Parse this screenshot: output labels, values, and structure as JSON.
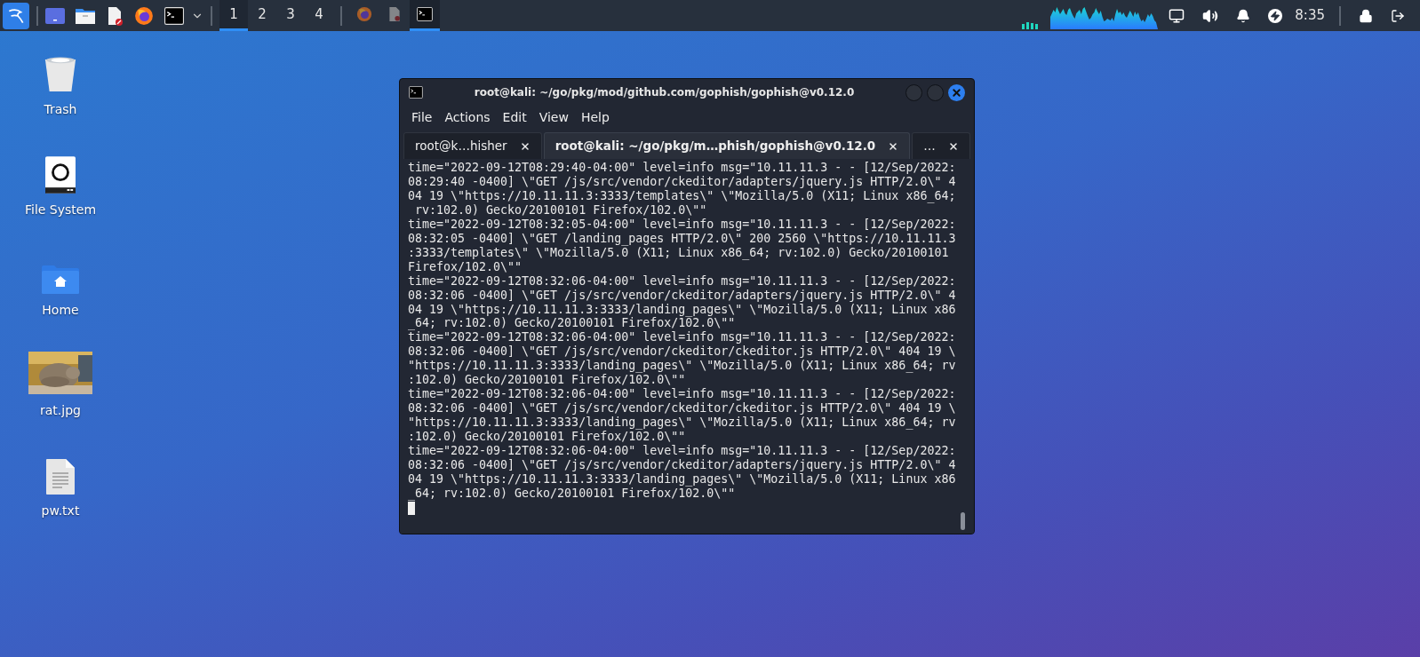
{
  "taskbar": {
    "workspaces": [
      {
        "label": "1",
        "selected": true
      },
      {
        "label": "2",
        "selected": false
      },
      {
        "label": "3",
        "selected": false
      },
      {
        "label": "4",
        "selected": false
      }
    ],
    "tasks": [
      {
        "kind": "browser",
        "selected": false
      },
      {
        "kind": "document",
        "selected": false
      },
      {
        "kind": "terminal",
        "selected": true
      }
    ],
    "clock": "8:35"
  },
  "desktop_icons": [
    {
      "label": "Trash",
      "kind": "trash"
    },
    {
      "label": "File System",
      "kind": "drive"
    },
    {
      "label": "Home",
      "kind": "home"
    },
    {
      "label": "rat.jpg",
      "kind": "picture"
    },
    {
      "label": "pw.txt",
      "kind": "text"
    }
  ],
  "terminal": {
    "title": "root@kali: ~/go/pkg/mod/github.com/gophish/gophish@v0.12.0",
    "menu": [
      "File",
      "Actions",
      "Edit",
      "View",
      "Help"
    ],
    "tabs": [
      {
        "label": "root@k…hisher",
        "selected": false
      },
      {
        "label": "root@kali: ~/go/pkg/m…phish/gophish@v0.12.0",
        "selected": true
      },
      {
        "label": "…",
        "selected": false
      }
    ],
    "lines": [
      "time=\"2022-09-12T08:29:40-04:00\" level=info msg=\"10.11.11.3 - - [12/Sep/2022:",
      "08:29:40 -0400] \\\"GET /js/src/vendor/ckeditor/adapters/jquery.js HTTP/2.0\\\" 4",
      "04 19 \\\"https://10.11.11.3:3333/templates\\\" \\\"Mozilla/5.0 (X11; Linux x86_64;",
      " rv:102.0) Gecko/20100101 Firefox/102.0\\\"\"",
      "time=\"2022-09-12T08:32:05-04:00\" level=info msg=\"10.11.11.3 - - [12/Sep/2022:",
      "08:32:05 -0400] \\\"GET /landing_pages HTTP/2.0\\\" 200 2560 \\\"https://10.11.11.3",
      ":3333/templates\\\" \\\"Mozilla/5.0 (X11; Linux x86_64; rv:102.0) Gecko/20100101",
      "Firefox/102.0\\\"\"",
      "time=\"2022-09-12T08:32:06-04:00\" level=info msg=\"10.11.11.3 - - [12/Sep/2022:",
      "08:32:06 -0400] \\\"GET /js/src/vendor/ckeditor/adapters/jquery.js HTTP/2.0\\\" 4",
      "04 19 \\\"https://10.11.11.3:3333/landing_pages\\\" \\\"Mozilla/5.0 (X11; Linux x86",
      "_64; rv:102.0) Gecko/20100101 Firefox/102.0\\\"\"",
      "time=\"2022-09-12T08:32:06-04:00\" level=info msg=\"10.11.11.3 - - [12/Sep/2022:",
      "08:32:06 -0400] \\\"GET /js/src/vendor/ckeditor/ckeditor.js HTTP/2.0\\\" 404 19 \\",
      "\"https://10.11.11.3:3333/landing_pages\\\" \\\"Mozilla/5.0 (X11; Linux x86_64; rv",
      ":102.0) Gecko/20100101 Firefox/102.0\\\"\"",
      "time=\"2022-09-12T08:32:06-04:00\" level=info msg=\"10.11.11.3 - - [12/Sep/2022:",
      "08:32:06 -0400] \\\"GET /js/src/vendor/ckeditor/ckeditor.js HTTP/2.0\\\" 404 19 \\",
      "\"https://10.11.11.3:3333/landing_pages\\\" \\\"Mozilla/5.0 (X11; Linux x86_64; rv",
      ":102.0) Gecko/20100101 Firefox/102.0\\\"\"",
      "time=\"2022-09-12T08:32:06-04:00\" level=info msg=\"10.11.11.3 - - [12/Sep/2022:",
      "08:32:06 -0400] \\\"GET /js/src/vendor/ckeditor/adapters/jquery.js HTTP/2.0\\\" 4",
      "04 19 \\\"https://10.11.11.3:3333/landing_pages\\\" \\\"Mozilla/5.0 (X11; Linux x86",
      "_64; rv:102.0) Gecko/20100101 Firefox/102.0\\\"\""
    ]
  }
}
